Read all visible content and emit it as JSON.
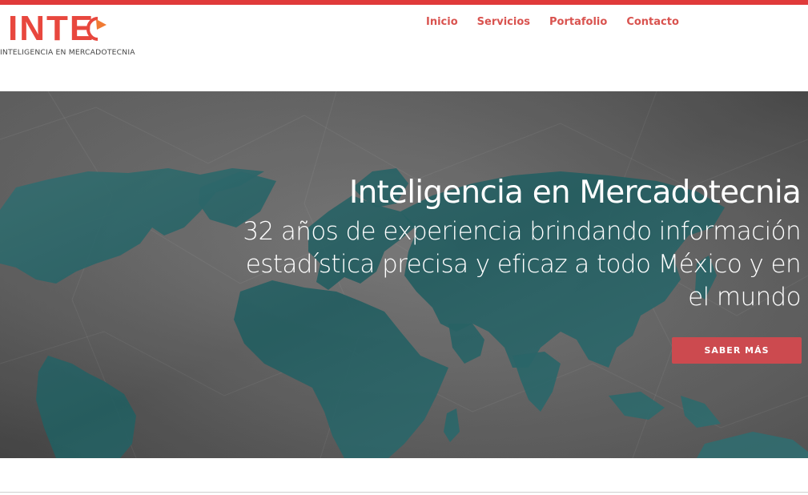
{
  "logo": {
    "wordmark": "INTE",
    "tagline": "INTELIGENCIA EN MERCADOTECNIA"
  },
  "nav": {
    "items": [
      {
        "label": "Inicio"
      },
      {
        "label": "Servicios"
      },
      {
        "label": "Portafolio"
      },
      {
        "label": "Contacto"
      }
    ]
  },
  "hero": {
    "title": "Inteligencia en Mercadotecnia",
    "subtitle": "32 años de experiencia brindando información estadística precisa y eficaz a todo México y en el mundo",
    "cta_label": "SABER MÁS"
  },
  "colors": {
    "accent": "#e03a3a",
    "nav_link": "#d9534f",
    "cta": "#cc4a4f",
    "map_land": "#2a6f72",
    "hero_bg": "#7a7a7a"
  },
  "icons": {
    "logo_mark": "circular-arrow-icon"
  }
}
